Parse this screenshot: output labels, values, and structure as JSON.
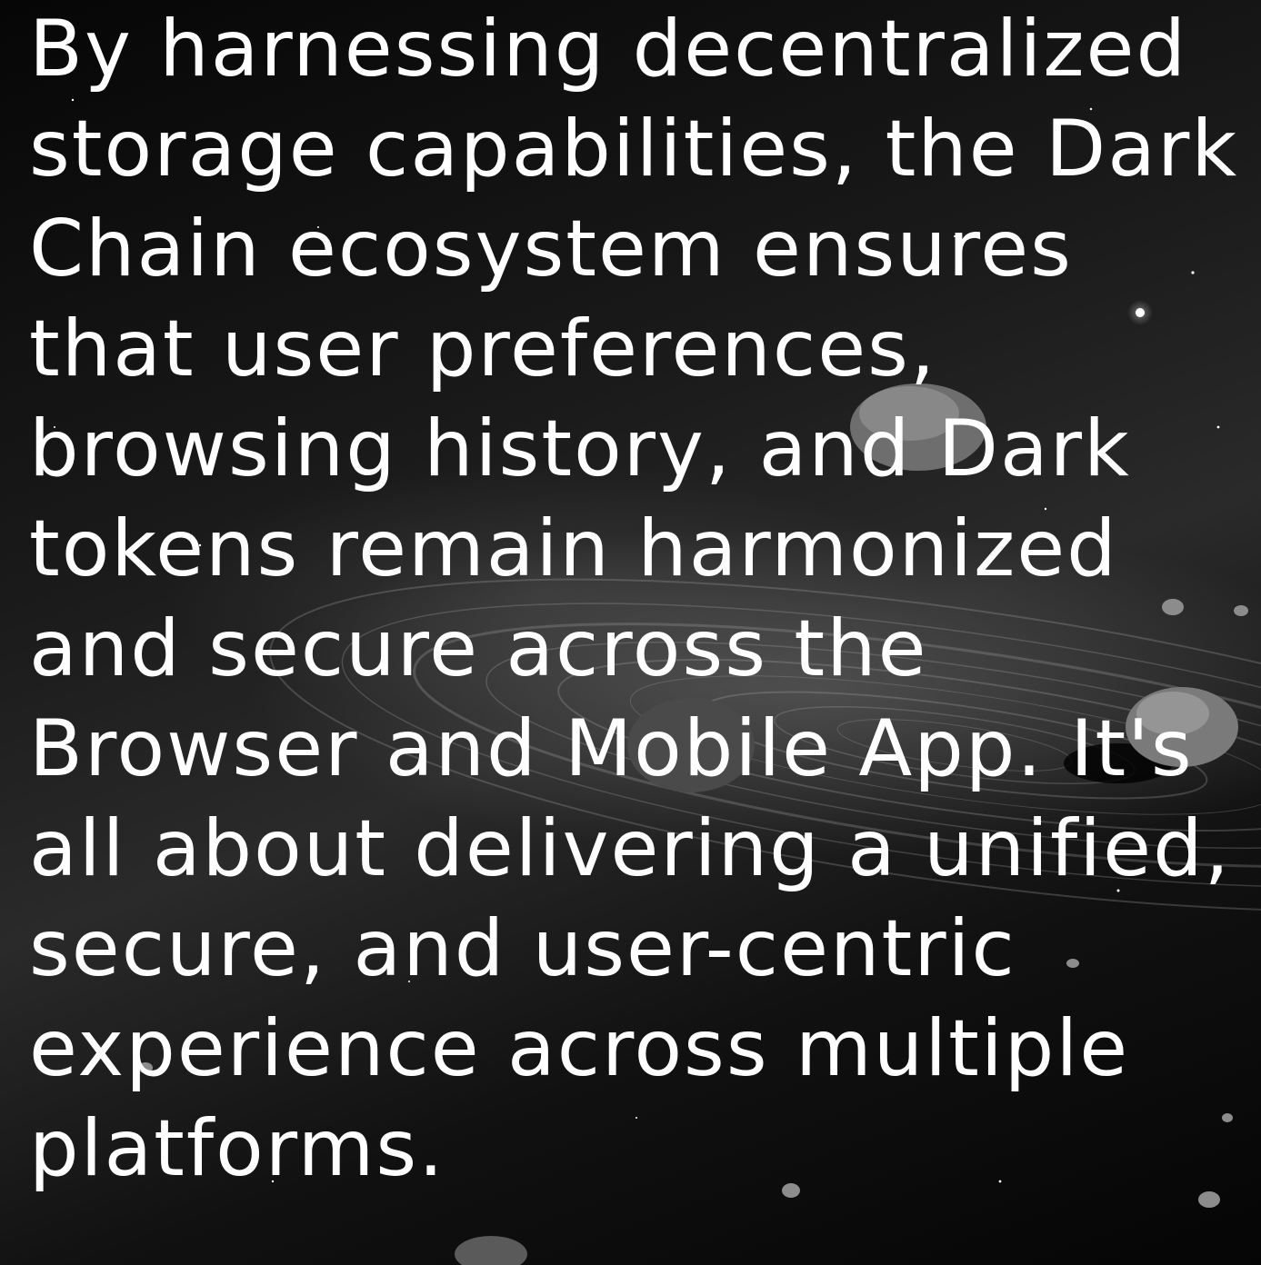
{
  "caption": {
    "lines": [
      "By harnessing decentralized",
      "storage capabilities, the Dark",
      "Chain ecosystem ensures",
      "that user preferences,",
      "browsing history, and Dark",
      "tokens remain harmonized",
      "and secure across the",
      "Browser and Mobile App. It's",
      "all about delivering a unified,",
      "secure, and user-centric",
      "experience across multiple",
      "platforms."
    ]
  },
  "background": {
    "description_icon": "planetary-rings-asteroids-illustration",
    "palette": [
      "#050505",
      "#2a2a2a",
      "#9a9a9a",
      "#ffffff"
    ]
  }
}
